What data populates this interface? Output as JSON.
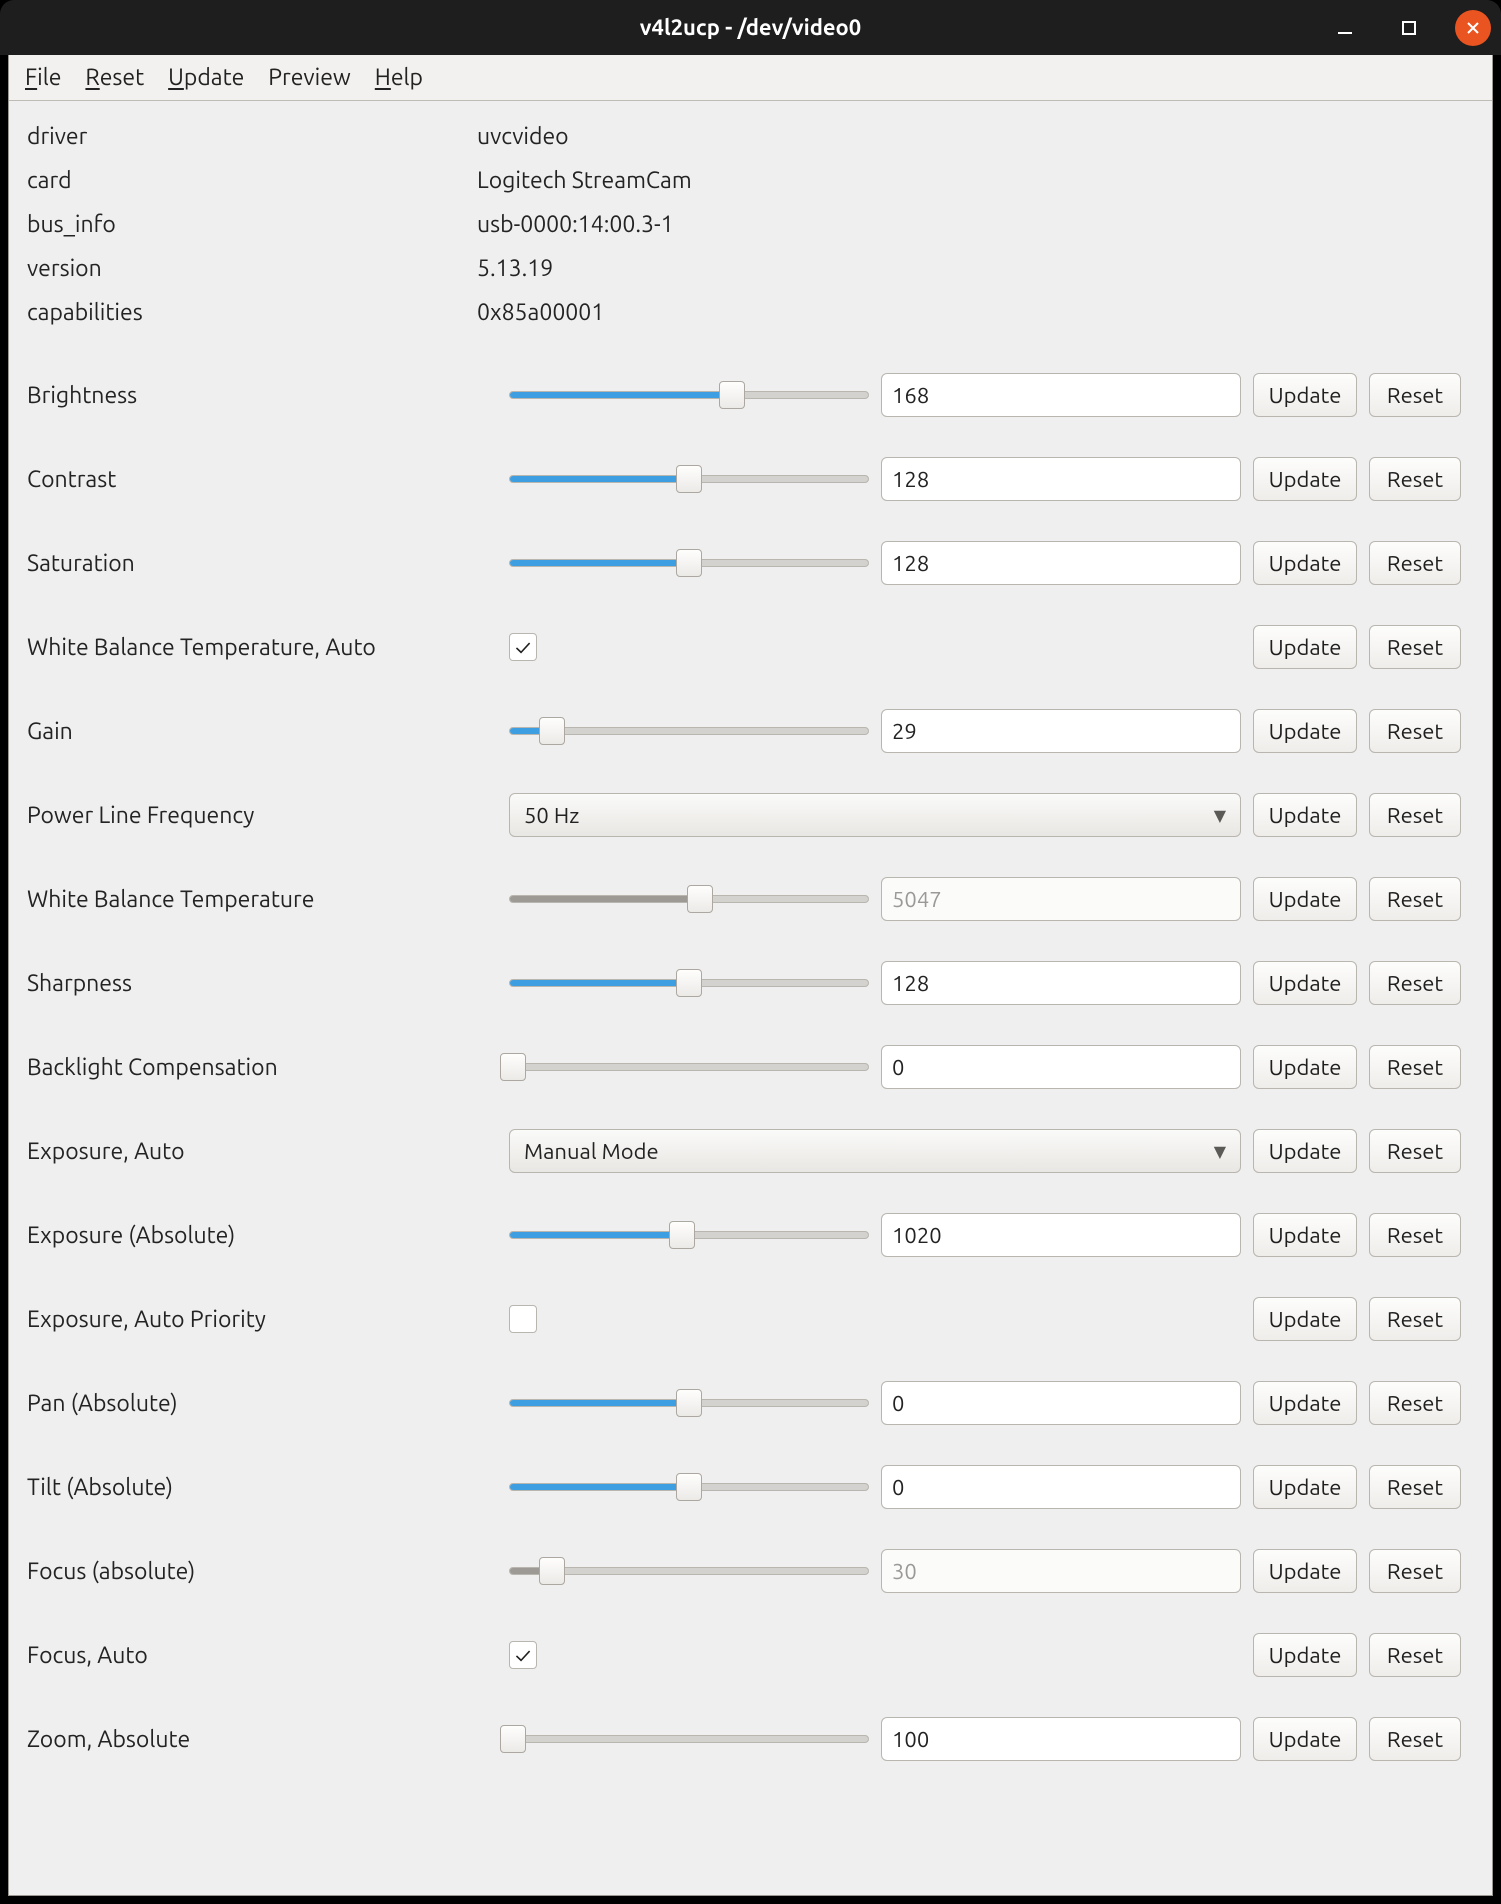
{
  "window": {
    "title": "v4l2ucp - /dev/video0"
  },
  "menubar": {
    "file": "File",
    "reset": "Reset",
    "update": "Update",
    "preview": "Preview",
    "help": "Help"
  },
  "buttons": {
    "update": "Update",
    "reset": "Reset"
  },
  "info": {
    "driver_label": "driver",
    "driver_value": "uvcvideo",
    "card_label": "card",
    "card_value": "Logitech StreamCam",
    "bus_info_label": "bus_info",
    "bus_info_value": "usb-0000:14:00.3-1",
    "version_label": "version",
    "version_value": "5.13.19",
    "capabilities_label": "capabilities",
    "capabilities_value": "0x85a00001"
  },
  "controls": {
    "brightness": {
      "label": "Brightness",
      "value": "168",
      "fill_pct": 62
    },
    "contrast": {
      "label": "Contrast",
      "value": "128",
      "fill_pct": 50
    },
    "saturation": {
      "label": "Saturation",
      "value": "128",
      "fill_pct": 50
    },
    "wb_auto": {
      "label": "White Balance Temperature, Auto",
      "checked": true
    },
    "gain": {
      "label": "Gain",
      "value": "29",
      "fill_pct": 12
    },
    "power_line": {
      "label": "Power Line Frequency",
      "selected": "50 Hz"
    },
    "wb_temp": {
      "label": "White Balance Temperature",
      "value": "5047",
      "fill_pct": 53,
      "disabled": true
    },
    "sharpness": {
      "label": "Sharpness",
      "value": "128",
      "fill_pct": 50
    },
    "backlight": {
      "label": "Backlight Compensation",
      "value": "0",
      "fill_pct": 1
    },
    "exposure_auto": {
      "label": "Exposure, Auto",
      "selected": "Manual Mode"
    },
    "exposure_abs": {
      "label": "Exposure (Absolute)",
      "value": "1020",
      "fill_pct": 48
    },
    "exposure_prio": {
      "label": "Exposure, Auto Priority",
      "checked": false
    },
    "pan": {
      "label": "Pan (Absolute)",
      "value": "0",
      "fill_pct": 50
    },
    "tilt": {
      "label": "Tilt (Absolute)",
      "value": "0",
      "fill_pct": 50
    },
    "focus_abs": {
      "label": "Focus (absolute)",
      "value": "30",
      "fill_pct": 12,
      "disabled": true
    },
    "focus_auto": {
      "label": "Focus, Auto",
      "checked": true
    },
    "zoom": {
      "label": "Zoom, Absolute",
      "value": "100",
      "fill_pct": 1
    }
  }
}
